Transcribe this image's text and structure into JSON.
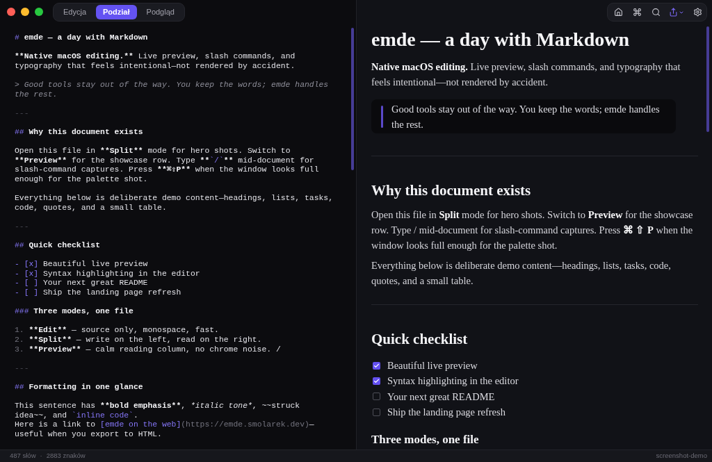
{
  "mode_tabs": [
    {
      "label": "Edycja",
      "selected": false
    },
    {
      "label": "Podział",
      "selected": true
    },
    {
      "label": "Podgląd",
      "selected": false
    }
  ],
  "editor": {
    "blocks": [
      {
        "lines": [
          [
            {
              "text": "#",
              "kind": "mark"
            },
            {
              "text": " emde — a day with Markdown",
              "kind": "bold"
            }
          ]
        ]
      },
      {
        "lines": [
          [
            {
              "text": "**Native macOS editing.**",
              "kind": "bold"
            },
            {
              "text": " Live preview, slash commands, and typography that feels intentional—not rendered by accident.",
              "kind": "text"
            }
          ]
        ]
      },
      {
        "lines": [
          [
            {
              "text": "> Good tools stay out of the way. You keep the words; emde handles the rest.",
              "kind": "quote"
            }
          ]
        ]
      },
      {
        "lines": [
          [
            {
              "text": "---",
              "kind": "rule"
            }
          ]
        ]
      },
      {
        "lines": [
          [
            {
              "text": "##",
              "kind": "mark"
            },
            {
              "text": " Why this document exists",
              "kind": "bold"
            }
          ]
        ]
      },
      {
        "lines": [
          [
            {
              "text": "Open this file in ",
              "kind": "text"
            },
            {
              "text": "**Split**",
              "kind": "bold"
            },
            {
              "text": " mode for hero shots. Switch to ",
              "kind": "text"
            },
            {
              "text": "**Preview**",
              "kind": "bold"
            },
            {
              "text": " for the showcase row. Type ",
              "kind": "text"
            },
            {
              "text": "**",
              "kind": "bold"
            },
            {
              "text": "`/`",
              "kind": "mark"
            },
            {
              "text": "**",
              "kind": "bold"
            },
            {
              "text": " mid-document for slash-command captures. Press ",
              "kind": "text"
            },
            {
              "text": "**⌘⇧P**",
              "kind": "bold"
            },
            {
              "text": " when the window looks full enough for the palette shot.",
              "kind": "text"
            }
          ]
        ]
      },
      {
        "lines": [
          [
            {
              "text": "Everything below is deliberate demo content—headings, lists, tasks, code, quotes, and a small table.",
              "kind": "text"
            }
          ]
        ]
      },
      {
        "lines": [
          [
            {
              "text": "---",
              "kind": "rule"
            }
          ]
        ]
      },
      {
        "lines": [
          [
            {
              "text": "##",
              "kind": "mark"
            },
            {
              "text": " Quick checklist",
              "kind": "bold"
            }
          ]
        ]
      },
      {
        "lines": [
          [
            {
              "text": "- [x]",
              "kind": "mark"
            },
            {
              "text": " Beautiful live preview",
              "kind": "text"
            }
          ],
          [
            {
              "text": "- [x]",
              "kind": "mark"
            },
            {
              "text": " Syntax highlighting in the editor",
              "kind": "text"
            }
          ],
          [
            {
              "text": "- [ ]",
              "kind": "mark"
            },
            {
              "text": " Your next great README",
              "kind": "text"
            }
          ],
          [
            {
              "text": "- [ ]",
              "kind": "mark"
            },
            {
              "text": " Ship the landing page refresh",
              "kind": "text"
            }
          ]
        ]
      },
      {
        "lines": [
          [
            {
              "text": "###",
              "kind": "mark"
            },
            {
              "text": " Three modes, one file",
              "kind": "bold"
            }
          ]
        ]
      },
      {
        "lines": [
          [
            {
              "text": "1.",
              "kind": "muted"
            },
            {
              "text": " **Edit**",
              "kind": "bold"
            },
            {
              "text": " — source only, monospace, fast.",
              "kind": "text"
            }
          ],
          [
            {
              "text": "2.",
              "kind": "muted"
            },
            {
              "text": " **Split**",
              "kind": "bold"
            },
            {
              "text": " — write on the left, read on the right.",
              "kind": "text"
            }
          ],
          [
            {
              "text": "3.",
              "kind": "muted"
            },
            {
              "text": " **Preview**",
              "kind": "bold"
            },
            {
              "text": " — calm reading column, no chrome noise. /",
              "kind": "text"
            }
          ]
        ]
      },
      {
        "lines": [
          [
            {
              "text": "---",
              "kind": "rule"
            }
          ]
        ]
      },
      {
        "lines": [
          [
            {
              "text": "##",
              "kind": "mark"
            },
            {
              "text": " Formatting in one glance",
              "kind": "bold"
            }
          ]
        ]
      },
      {
        "lines": [
          [
            {
              "text": "This sentence has ",
              "kind": "text"
            },
            {
              "text": "**bold emphasis**",
              "kind": "bold"
            },
            {
              "text": ", ",
              "kind": "text"
            },
            {
              "text": "*italic tone*",
              "kind": "italic"
            },
            {
              "text": ", ~~struck idea~~, and ",
              "kind": "text"
            },
            {
              "text": "`inline code`",
              "kind": "mark"
            },
            {
              "text": ".",
              "kind": "text"
            }
          ],
          [
            {
              "text": "Here is a link to ",
              "kind": "text"
            },
            {
              "text": "[emde on the web]",
              "kind": "mark"
            },
            {
              "text": "(https://emde.smolarek.dev)",
              "kind": "muted"
            },
            {
              "text": "—useful when you export to HTML.",
              "kind": "text"
            }
          ]
        ]
      }
    ]
  },
  "preview": {
    "blocks": [
      {
        "kind": "title",
        "text": "emde — a day with Markdown"
      },
      {
        "kind": "paragraph",
        "text": "**Native macOS editing.** Live preview, slash commands, and typography that feels intentional—not rendered by accident."
      },
      {
        "kind": "quote",
        "text": "Good tools stay out of the way. You keep the words; emde handles the rest."
      },
      {
        "kind": "rule"
      },
      {
        "kind": "heading",
        "text": "Why this document exists"
      },
      {
        "kind": "paragraph",
        "text": "Open this file in **Split** mode for hero shots. Switch to **Preview** for the showcase row. Type / mid-document for slash-command captures. Press **⌘ ⇧ P** when the window looks full enough for the palette shot."
      },
      {
        "kind": "paragraph",
        "text": "Everything below is deliberate demo content—headings, lists, tasks, code, quotes, and a small table."
      },
      {
        "kind": "rule"
      },
      {
        "kind": "heading",
        "text": "Quick checklist"
      },
      {
        "kind": "tasks",
        "items": [
          {
            "label": "Beautiful live preview",
            "checked": true
          },
          {
            "label": "Syntax highlighting in the editor",
            "checked": true
          },
          {
            "label": "Your next great README",
            "checked": false
          },
          {
            "label": "Ship the landing page refresh",
            "checked": false
          }
        ]
      },
      {
        "kind": "subheading",
        "text": "Three modes, one file"
      }
    ]
  },
  "status_bar": {
    "word_count": "487 słów",
    "separator": "·",
    "char_count": "2883 znaków",
    "document": "screenshot-demo"
  }
}
